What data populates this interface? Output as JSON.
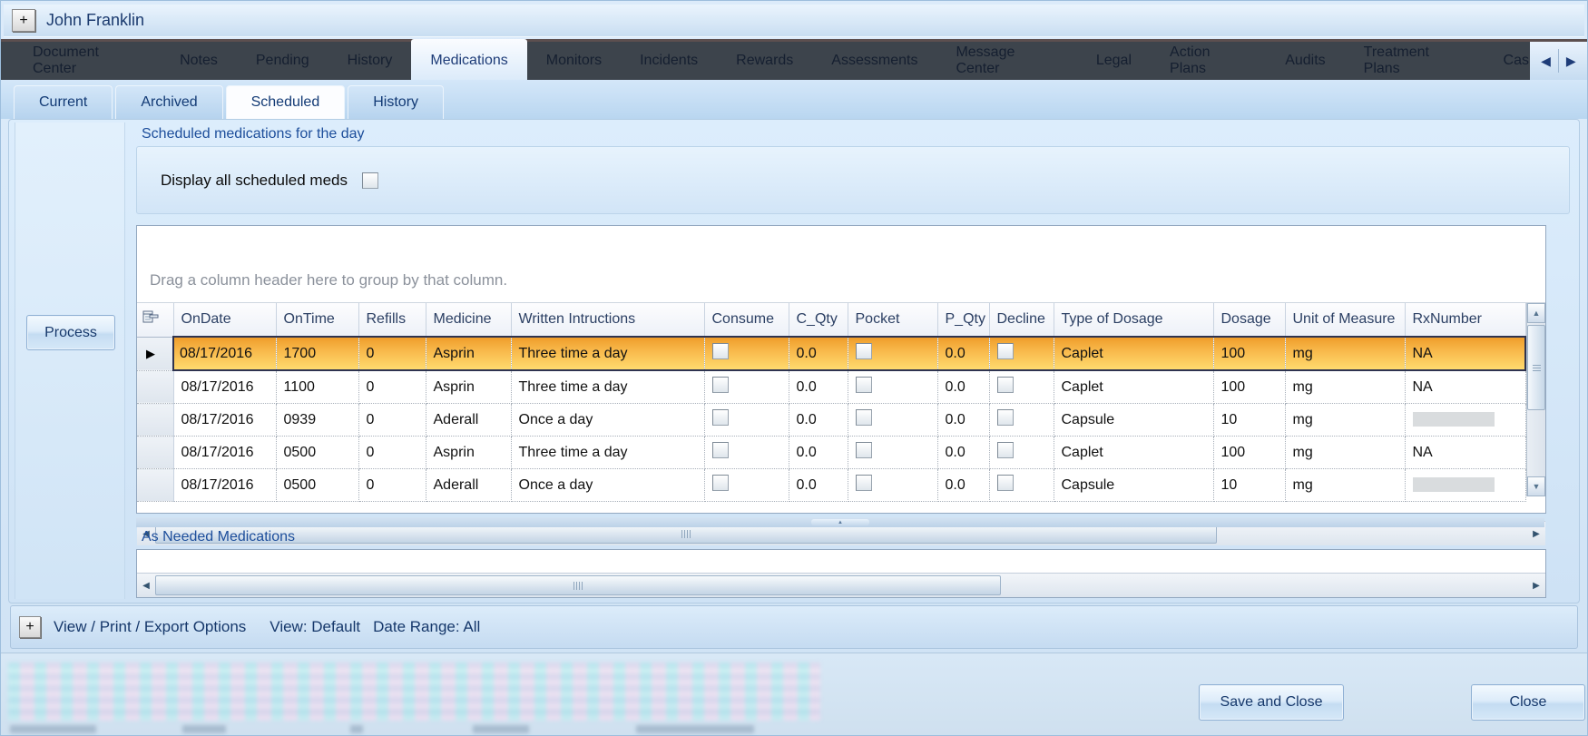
{
  "window": {
    "expand_button": "+",
    "patient_name": "John Franklin"
  },
  "nav": {
    "tabs": [
      "Document Center",
      "Notes",
      "Pending",
      "History",
      "Medications",
      "Monitors",
      "Incidents",
      "Rewards",
      "Assessments",
      "Message Center",
      "Legal",
      "Action Plans",
      "Audits",
      "Treatment Plans",
      "Cas"
    ],
    "selected_index": 4,
    "scroll_left_icon": "◀",
    "scroll_right_icon": "▶"
  },
  "subnav": {
    "tabs": [
      "Current",
      "Archived",
      "Scheduled",
      "History"
    ],
    "selected_index": 2
  },
  "scheduled_section": {
    "title": "Scheduled medications for the day",
    "display_all_label": "Display all scheduled meds",
    "display_all_checked": false,
    "process_button": "Process",
    "group_by_hint": "Drag a column header here to group by that column.",
    "columns": [
      "OnDate",
      "OnTime",
      "Refills",
      "Medicine",
      "Written Intructions",
      "Consume",
      "C_Qty",
      "Pocket",
      "P_Qty",
      "Decline",
      "Type of Dosage",
      "Dosage",
      "Unit of Measure",
      "RxNumber"
    ],
    "rows": [
      {
        "selected": true,
        "on_date": "08/17/2016",
        "on_time": "1700",
        "refills": "0",
        "medicine": "Asprin",
        "instructions": "Three time a day",
        "consume": false,
        "c_qty": "0.0",
        "pocket": false,
        "p_qty": "0.0",
        "decline": false,
        "dosage_type": "Caplet",
        "dosage": "100",
        "unit": "mg",
        "rx_number": "NA",
        "rx_redacted": false
      },
      {
        "selected": false,
        "on_date": "08/17/2016",
        "on_time": "1100",
        "refills": "0",
        "medicine": "Asprin",
        "instructions": "Three time a day",
        "consume": false,
        "c_qty": "0.0",
        "pocket": false,
        "p_qty": "0.0",
        "decline": false,
        "dosage_type": "Caplet",
        "dosage": "100",
        "unit": "mg",
        "rx_number": "NA",
        "rx_redacted": false
      },
      {
        "selected": false,
        "on_date": "08/17/2016",
        "on_time": "0939",
        "refills": "0",
        "medicine": "Aderall",
        "instructions": "Once a day",
        "consume": false,
        "c_qty": "0.0",
        "pocket": false,
        "p_qty": "0.0",
        "decline": false,
        "dosage_type": "Capsule",
        "dosage": "10",
        "unit": "mg",
        "rx_number": "",
        "rx_redacted": true
      },
      {
        "selected": false,
        "on_date": "08/17/2016",
        "on_time": "0500",
        "refills": "0",
        "medicine": "Asprin",
        "instructions": "Three time a day",
        "consume": false,
        "c_qty": "0.0",
        "pocket": false,
        "p_qty": "0.0",
        "decline": false,
        "dosage_type": "Caplet",
        "dosage": "100",
        "unit": "mg",
        "rx_number": "NA",
        "rx_redacted": false
      },
      {
        "selected": false,
        "on_date": "08/17/2016",
        "on_time": "0500",
        "refills": "0",
        "medicine": "Aderall",
        "instructions": "Once a day",
        "consume": false,
        "c_qty": "0.0",
        "pocket": false,
        "p_qty": "0.0",
        "decline": false,
        "dosage_type": "Capsule",
        "dosage": "10",
        "unit": "mg",
        "rx_number": "",
        "rx_redacted": true
      }
    ]
  },
  "as_needed_section": {
    "title": "As Needed Medications"
  },
  "options_bar": {
    "expand_button": "+",
    "label": "View / Print / Export Options",
    "view_label": "View: Default",
    "date_range_label": "Date Range: All"
  },
  "footer": {
    "save_and_close_button": "Save and Close",
    "close_button": "Close"
  },
  "colors": {
    "selected_row_orange": "#f7a828",
    "nav_bar": "#3d444c",
    "accent_text": "#1b3a6e",
    "redaction_grey": "#d9dcde"
  }
}
